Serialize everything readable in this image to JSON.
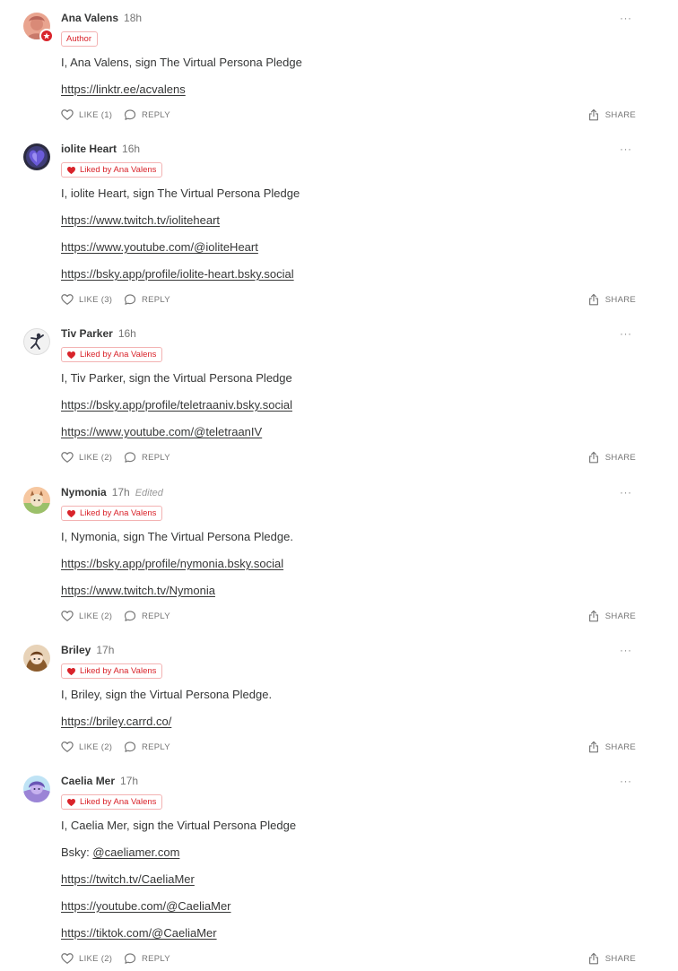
{
  "ui": {
    "more_glyph": "···",
    "like_label": "LIKE",
    "reply_label": "REPLY",
    "share_label": "SHARE",
    "author_badge": "Author",
    "liked_by_badge": "Liked by Ana Valens",
    "accent_color": "#d9232a",
    "text_color": "#363737",
    "muted_color": "#757575"
  },
  "comments": [
    {
      "name": "Ana Valens",
      "time": "18h",
      "badge": "Author",
      "text": "I, Ana Valens, sign The Virtual Persona Pledge",
      "links": [
        "https://linktr.ee/acvalens"
      ],
      "like_count": "(1)"
    },
    {
      "name": "iolite Heart",
      "time": "16h",
      "badge": "Liked by Ana Valens",
      "text": "I, iolite Heart, sign The Virtual Persona Pledge",
      "links": [
        "https://www.twitch.tv/ioliteheart",
        "https://www.youtube.com/@ioliteHeart",
        "https://bsky.app/profile/iolite-heart.bsky.social"
      ],
      "like_count": "(3)"
    },
    {
      "name": "Tiv Parker",
      "time": "16h",
      "badge": "Liked by Ana Valens",
      "text": "I, Tiv Parker, sign the Virtual Persona Pledge",
      "links": [
        "https://bsky.app/profile/teletraaniv.bsky.social",
        "https://www.youtube.com/@teletraanIV"
      ],
      "like_count": "(2)"
    },
    {
      "name": "Nymonia",
      "time": "17h",
      "edited": "Edited",
      "badge": "Liked by Ana Valens",
      "text": "I, Nymonia, sign The Virtual Persona Pledge.",
      "links": [
        "https://bsky.app/profile/nymonia.bsky.social",
        "https://www.twitch.tv/Nymonia"
      ],
      "like_count": "(2)"
    },
    {
      "name": "Briley",
      "time": "17h",
      "badge": "Liked by Ana Valens",
      "text": "I, Briley, sign the Virtual Persona Pledge.",
      "links": [
        "https://briley.carrd.co/"
      ],
      "like_count": "(2)"
    },
    {
      "name": "Caelia Mer",
      "time": "17h",
      "badge": "Liked by Ana Valens",
      "text": "I, Caelia Mer, sign the Virtual Persona Pledge",
      "bsky_prefix": "Bsky: ",
      "bsky_handle": "@caeliamer.com",
      "links": [
        "https://twitch.tv/CaeliaMer",
        "https://youtube.com/@CaeliaMer",
        "https://tiktok.com/@CaeliaMer"
      ],
      "like_count": "(2)"
    }
  ]
}
